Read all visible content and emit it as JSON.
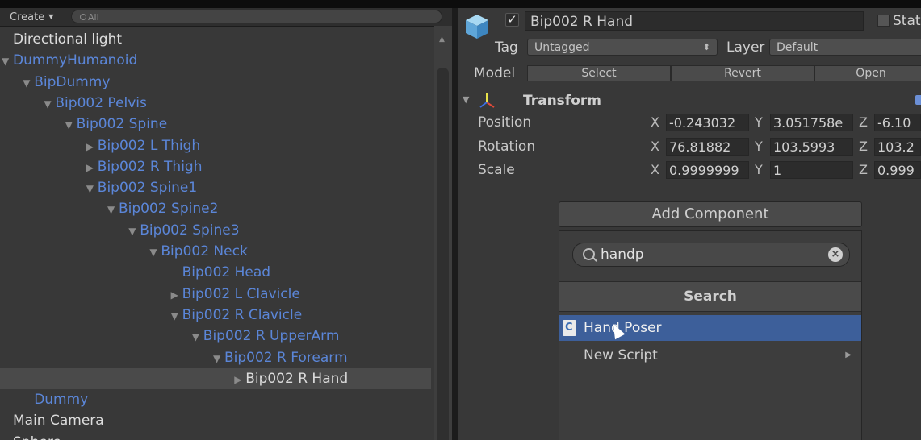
{
  "hierarchy": {
    "create_label": "Create",
    "search_placeholder": "All",
    "tree": [
      {
        "label": "Directional light",
        "depth": 0,
        "arrow": "",
        "color": "white"
      },
      {
        "label": "DummyHumanoid",
        "depth": 0,
        "arrow": "down",
        "color": "blue"
      },
      {
        "label": "BipDummy",
        "depth": 1,
        "arrow": "down",
        "color": "blue"
      },
      {
        "label": "Bip002 Pelvis",
        "depth": 2,
        "arrow": "down",
        "color": "blue"
      },
      {
        "label": "Bip002 Spine",
        "depth": 3,
        "arrow": "down",
        "color": "blue"
      },
      {
        "label": "Bip002 L Thigh",
        "depth": 4,
        "arrow": "right",
        "color": "blue"
      },
      {
        "label": "Bip002 R Thigh",
        "depth": 4,
        "arrow": "right",
        "color": "blue"
      },
      {
        "label": "Bip002 Spine1",
        "depth": 4,
        "arrow": "down",
        "color": "blue"
      },
      {
        "label": "Bip002 Spine2",
        "depth": 5,
        "arrow": "down",
        "color": "blue"
      },
      {
        "label": "Bip002 Spine3",
        "depth": 6,
        "arrow": "down",
        "color": "blue"
      },
      {
        "label": "Bip002 Neck",
        "depth": 7,
        "arrow": "down",
        "color": "blue"
      },
      {
        "label": "Bip002 Head",
        "depth": 8,
        "arrow": "",
        "color": "blue"
      },
      {
        "label": "Bip002 L Clavicle",
        "depth": 8,
        "arrow": "right",
        "color": "blue"
      },
      {
        "label": "Bip002 R Clavicle",
        "depth": 8,
        "arrow": "down",
        "color": "blue"
      },
      {
        "label": "Bip002 R UpperArm",
        "depth": 9,
        "arrow": "down",
        "color": "blue"
      },
      {
        "label": "Bip002 R Forearm",
        "depth": 10,
        "arrow": "down",
        "color": "blue"
      },
      {
        "label": "Bip002 R Hand",
        "depth": 11,
        "arrow": "right",
        "color": "white",
        "selected": true
      },
      {
        "label": "Dummy",
        "depth": 1,
        "arrow": "",
        "color": "blue"
      },
      {
        "label": "Main Camera",
        "depth": 0,
        "arrow": "",
        "color": "white"
      },
      {
        "label": "Sphere",
        "depth": 0,
        "arrow": "down",
        "color": "white"
      }
    ]
  },
  "inspector": {
    "object_name": "Bip002 R Hand",
    "active": true,
    "static_label": "Stat",
    "tag_label": "Tag",
    "tag_value": "Untagged",
    "layer_label": "Layer",
    "layer_value": "Default",
    "model_label": "Model",
    "model_buttons": [
      "Select",
      "Revert",
      "Open"
    ],
    "transform": {
      "title": "Transform",
      "rows": [
        {
          "name": "Position",
          "x": "-0.243032",
          "y": "3.051758e",
          "z": "-6.10"
        },
        {
          "name": "Rotation",
          "x": "76.81882",
          "y": "103.5993",
          "z": "103.2"
        },
        {
          "name": "Scale",
          "x": "0.9999999",
          "y": "1",
          "z": "0.999"
        }
      ]
    },
    "add_component": {
      "button_label": "Add Component",
      "search_value": "handp",
      "search_header": "Search",
      "results": [
        {
          "label": "Hand Poser",
          "selected": true
        },
        {
          "label": "New Script",
          "submenu": true
        }
      ]
    }
  },
  "axis_labels": {
    "x": "X",
    "y": "Y",
    "z": "Z"
  },
  "colors": {
    "panel_bg": "#383838",
    "hierarchy_blue": "#5b86d8",
    "selection": "#3d5f9a"
  }
}
